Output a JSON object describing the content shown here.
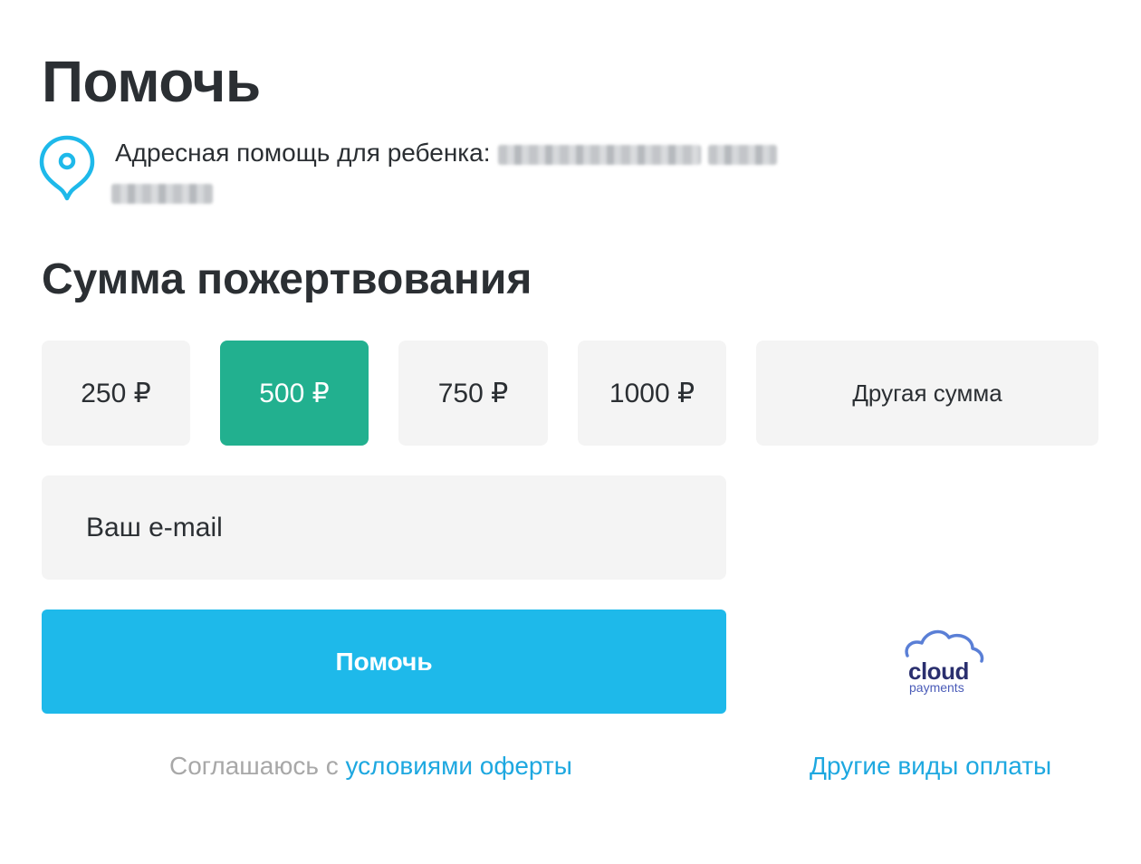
{
  "page": {
    "title": "Помочь"
  },
  "address": {
    "icon": "location-pin-icon",
    "label": "Адресная помощь для ребенка:"
  },
  "donation": {
    "title": "Сумма пожертвования",
    "amounts": [
      {
        "label": "250 ₽",
        "selected": false
      },
      {
        "label": "500 ₽",
        "selected": true
      },
      {
        "label": "750 ₽",
        "selected": false
      },
      {
        "label": "1000 ₽",
        "selected": false
      }
    ],
    "other_amount_label": "Другая сумма"
  },
  "email": {
    "value": "",
    "placeholder": "Ваш e-mail"
  },
  "submit": {
    "label": "Помочь"
  },
  "payment_provider": {
    "icon": "cloud-icon",
    "name_main": "cloud",
    "name_sub": "payments"
  },
  "agreement": {
    "prefix": "Соглашаюсь с",
    "link": "условиями оферты"
  },
  "other_payment": {
    "label": "Другие виды оплаты"
  },
  "colors": {
    "accent": "#1eb9ea",
    "selected": "#22b08f",
    "link": "#1ea8e0",
    "text": "#2b2f33"
  }
}
